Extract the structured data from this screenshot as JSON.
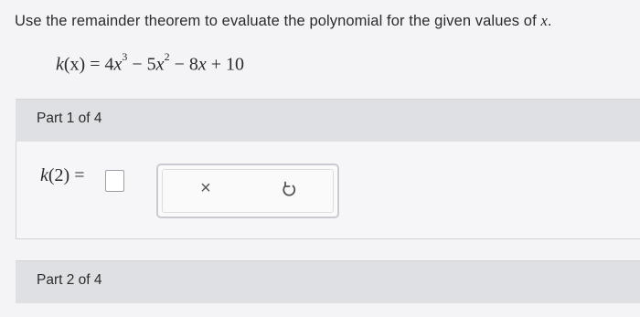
{
  "question": {
    "text": "Use the remainder theorem to evaluate the polynomial for the given values of",
    "variable": "x",
    "period": "."
  },
  "equation": {
    "func": "k",
    "lhs_arg": "(x)",
    "eq": "=",
    "c1": "4",
    "v1": "x",
    "e1": "3",
    "op1": "−",
    "c2": "5",
    "v2": "x",
    "e2": "2",
    "op2": "−",
    "c3": "8",
    "v3": "x",
    "op3": "+",
    "c4": "10"
  },
  "parts": [
    {
      "label": "Part 1 of 4"
    },
    {
      "label": "Part 2 of 4"
    }
  ],
  "answer": {
    "func": "k",
    "arg": "(2)",
    "eq": "="
  },
  "tools": {
    "clear_icon": "clear-icon",
    "clear_glyph": "×",
    "undo_icon": "undo-icon"
  }
}
